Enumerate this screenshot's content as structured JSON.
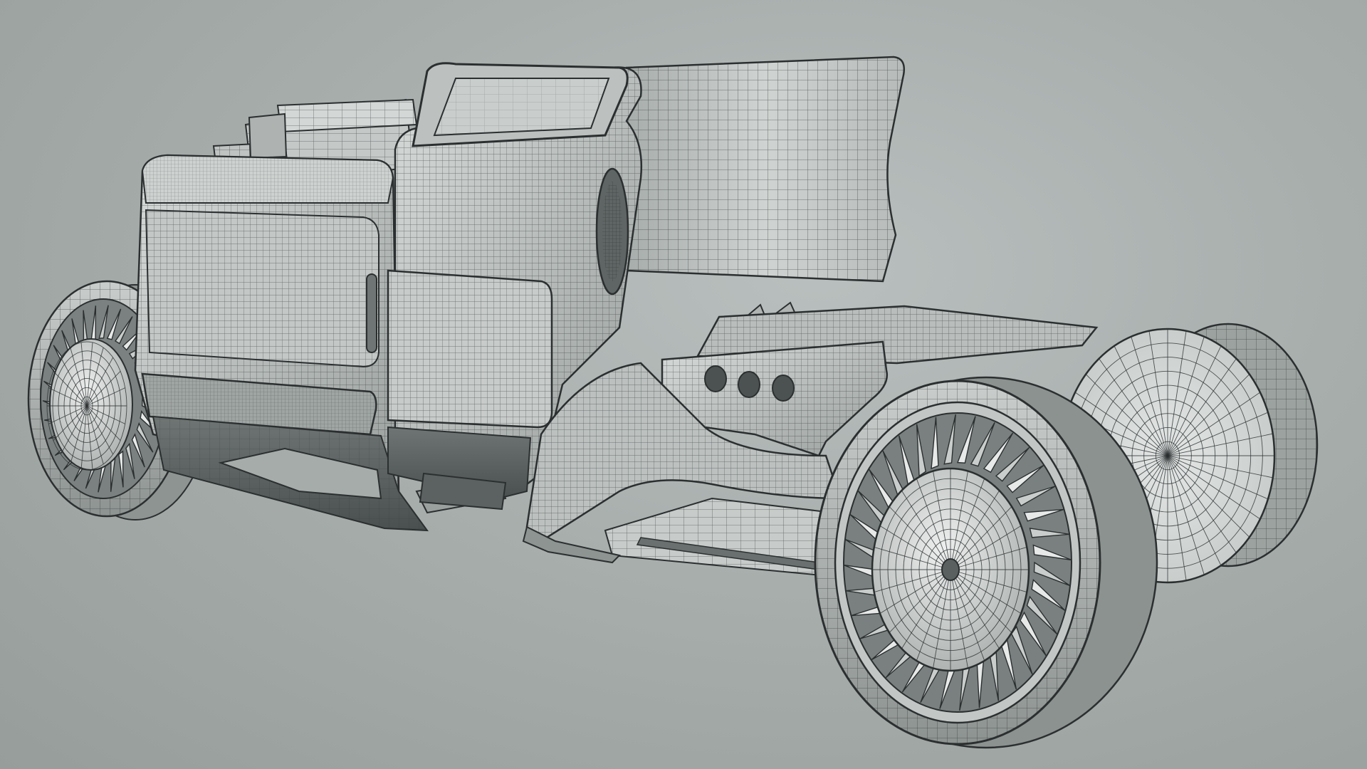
{
  "scene": {
    "subject": "hot-rod-vehicle-model",
    "view": "wireframe-on-shaded",
    "colors": {
      "background_center": "#b9bfbe",
      "background_edge": "#979d9b",
      "body_light": "#d4d8d6",
      "body_mid": "#b3b8b6",
      "body_dark": "#7f8583",
      "wire": "#2b2f30",
      "glass": "#c9cecc"
    }
  }
}
